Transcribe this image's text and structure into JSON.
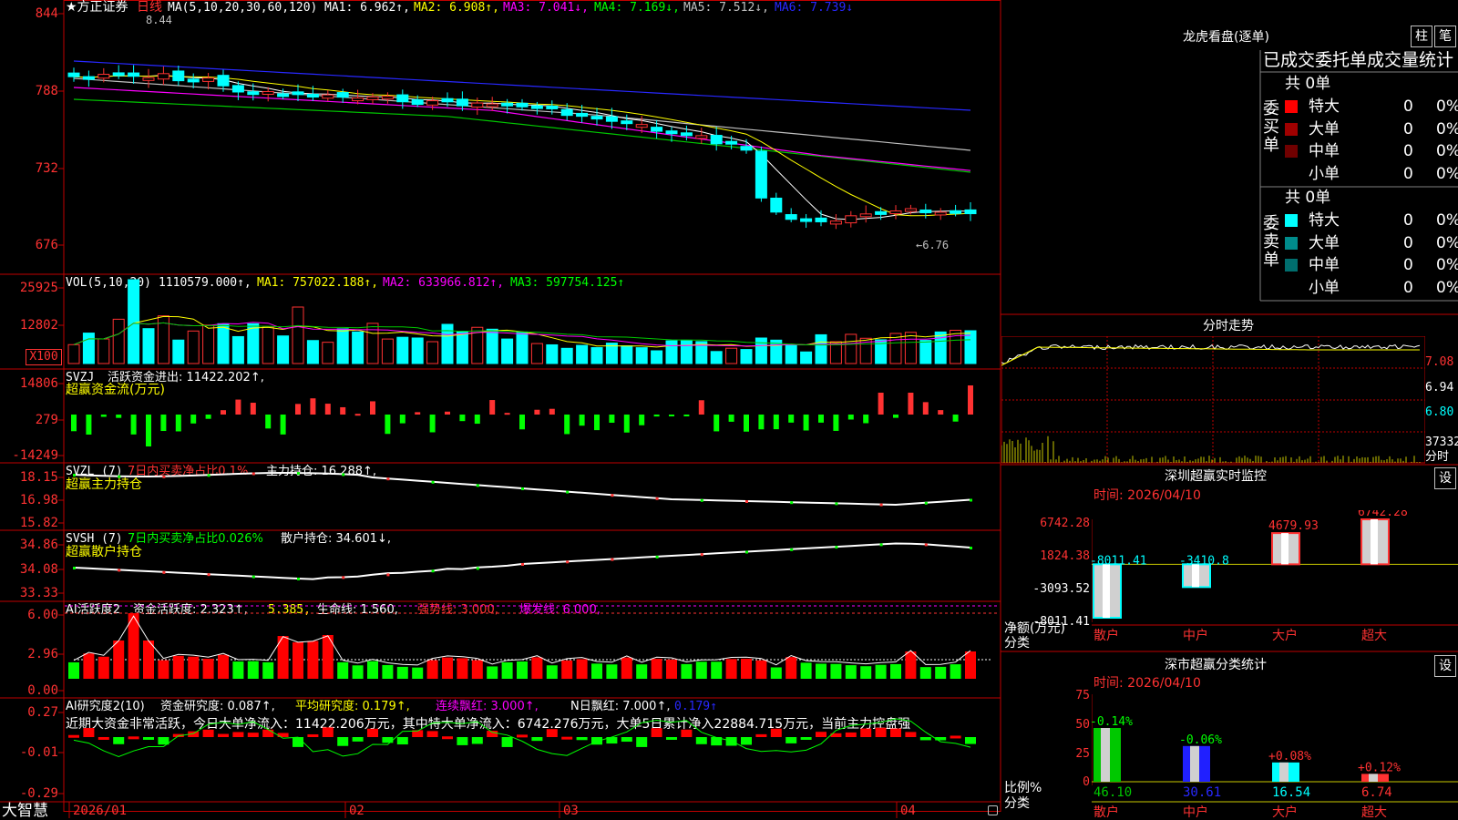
{
  "stock": {
    "name": "★方正证券",
    "period": "日线"
  },
  "kline": {
    "params": "MA(5,10,20,30,60,120)",
    "ma1": "MA1: 6.962↑,",
    "ma2": "MA2: 6.908↑,",
    "ma3": "MA3: 7.041↓,",
    "ma4": "MA4: 7.169↓,",
    "ma5": "MA5: 7.512↓,",
    "ma6": "MA6: 7.739↓",
    "y_labels": [
      "844",
      "788",
      "732",
      "676"
    ],
    "high_label": "8.44",
    "low_label": "←6.76"
  },
  "vol": {
    "title": "VOL(5,10,20)",
    "value": "1110579.000↑,",
    "ma1": "MA1: 757022.188↑,",
    "ma2": "MA2: 633966.812↑,",
    "ma3": "MA3: 597754.125↑",
    "y_labels": [
      "25925",
      "12802"
    ],
    "unit": "X100"
  },
  "svzj": {
    "title": "SVZJ",
    "label": "活跃资金进出: 11422.202↑,",
    "sub": "超赢资金流(万元)",
    "y_labels": [
      "14806",
      "279",
      "-14249"
    ]
  },
  "svzl": {
    "title": "SVZL (7)",
    "ratio": "7日内买卖净占比0.1%",
    "hold": "主力持仓: 16.288↑,",
    "sub": "超赢主力持仓",
    "y_labels": [
      "18.15",
      "16.98",
      "15.82"
    ]
  },
  "svsh": {
    "title": "SVSH (7)",
    "ratio": "7日内买卖净占比0.026%",
    "hold": "散户持仓: 34.601↓,",
    "sub": "超赢散户持仓",
    "y_labels": [
      "34.86",
      "34.08",
      "33.33"
    ]
  },
  "ai1": {
    "title": "AI活跃度2",
    "a": "资金活跃度: 2.323↑,",
    "b": "5.385,",
    "c": "生命线: 1.560,",
    "d": "强势线: 3.000,",
    "e": "爆发线: 6.000,",
    "y_labels": [
      "6.00",
      "2.96",
      "0.00"
    ]
  },
  "ai2": {
    "title": "AI研究度2(10)",
    "a": "资金研究度: 0.087↑,",
    "b": "平均研究度: 0.179↑,",
    "c": "连续飘红: 3.000↑,",
    "d": "N日飘红: 7.000↑,",
    "e": "0.179↑",
    "text": "近期大资金非常活跃，今日大单净流入：11422.206万元，其中特大单净流入：6742.276万元，大单5日累计净入22884.715万元，当前主力控盘强",
    "y_labels": [
      "0.27",
      "-0.01",
      "-0.29"
    ]
  },
  "xaxis": [
    "2026/01",
    "02",
    "03",
    "04"
  ],
  "brand": "大智慧",
  "longhu": {
    "title": "龙虎看盘(逐单)",
    "tab1": "柱",
    "tab2": "笔",
    "stats_title": "已成交委托单成交量统计",
    "buy_label": "委买单",
    "sell_label": "委卖单",
    "buy_total": "共 0单",
    "sell_total": "共 0单",
    "buy_rows": [
      {
        "name": "特大",
        "val": "0",
        "pct": "0%",
        "color": "#ff0000"
      },
      {
        "name": "大单",
        "val": "0",
        "pct": "0%",
        "color": "#a00000"
      },
      {
        "name": "中单",
        "val": "0",
        "pct": "0%",
        "color": "#700000"
      },
      {
        "name": "小单",
        "val": "0",
        "pct": "0%",
        "color": ""
      }
    ],
    "sell_rows": [
      {
        "name": "特大",
        "val": "0",
        "pct": "0%",
        "color": "#00ffff"
      },
      {
        "name": "大单",
        "val": "0",
        "pct": "0%",
        "color": "#008c8c"
      },
      {
        "name": "中单",
        "val": "0",
        "pct": "0%",
        "color": "#006e6e"
      },
      {
        "name": "小单",
        "val": "0",
        "pct": "0%",
        "color": ""
      }
    ]
  },
  "fenshi": {
    "title": "分时走势",
    "y1": "7.08",
    "y2": "6.94",
    "y3": "6.80",
    "vol": "37332",
    "unit": "分时"
  },
  "monitor": {
    "title": "深圳超赢实时监控",
    "set": "设",
    "time": "时间: 2026/04/10",
    "y_labels": [
      "6742.28",
      "1824.38",
      "-3093.52",
      "-8011.41"
    ],
    "ylabel1": "净额(万元)",
    "ylabel2": "分类",
    "categories": [
      "散户",
      "中户",
      "大户",
      "超大"
    ],
    "bar_labels": [
      "-8011.41",
      "-3410.8",
      "4679.93",
      "6742.28"
    ]
  },
  "classify": {
    "title": "深市超赢分类统计",
    "set": "设",
    "time": "时间: 2026/04/10",
    "y_labels": [
      "75",
      "50",
      "25",
      "0"
    ],
    "ylabel1": "比例%",
    "ylabel2": "分类",
    "categories": [
      "散户",
      "中户",
      "大户",
      "超大"
    ],
    "pct_labels": [
      "-0.14%",
      "-0.06%",
      "+0.08%",
      "+0.12%"
    ],
    "bottom_labels": [
      "46.10",
      "30.61",
      "16.54",
      "6.74"
    ]
  },
  "chart_data": [
    {
      "type": "bar",
      "title": "深圳超赢实时监控",
      "ylabel": "净额(万元)",
      "xlabel": "分类",
      "categories": [
        "散户",
        "中户",
        "大户",
        "超大"
      ],
      "values": [
        -8011.41,
        -3410.8,
        4679.93,
        6742.28
      ],
      "ylim": [
        -8011.41,
        6742.28
      ]
    },
    {
      "type": "bar",
      "title": "深市超赢分类统计",
      "ylabel": "比例%",
      "xlabel": "分类",
      "categories": [
        "散户",
        "中户",
        "大户",
        "超大"
      ],
      "values": [
        46.1,
        30.61,
        16.54,
        6.74
      ],
      "ylim": [
        0,
        75
      ]
    }
  ]
}
